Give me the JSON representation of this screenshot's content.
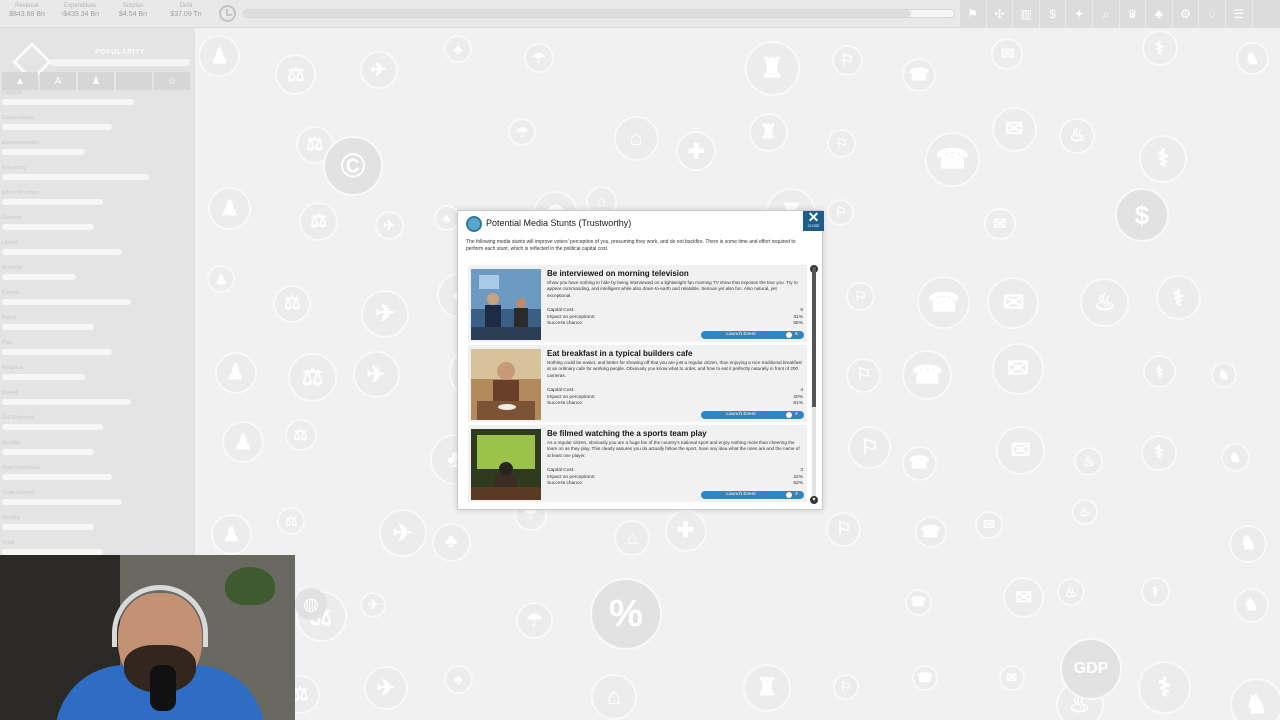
{
  "topbar": {
    "stats": [
      {
        "label": "Revenue",
        "value": "$843.88 Bn"
      },
      {
        "label": "Expenditure",
        "value": "-$439.34 Bn"
      },
      {
        "label": "Surplus",
        "value": "$4.54 Bn"
      },
      {
        "label": "Debt",
        "value": "$37.09 Tn"
      }
    ],
    "time_progress": 0.94,
    "icons": [
      "flag-icon",
      "network-icon",
      "chart-icon",
      "dollar-icon",
      "lightbulb-icon",
      "search-icon",
      "trophy-icon",
      "people-icon",
      "gear-icon",
      "bulb-icon",
      "menu-icon"
    ]
  },
  "left_panel": {
    "title": "POPULARITY",
    "tabs": [
      "up-arrow-icon",
      "text-icon",
      "people-icon",
      "blank-icon",
      "face-icon"
    ],
    "rows": [
      {
        "label": "Capitalist",
        "fill": 0.72
      },
      {
        "label": "Conservatives",
        "fill": 0.6
      },
      {
        "label": "Environmentalist",
        "fill": 0.45
      },
      {
        "label": "Everybody",
        "fill": 0.8
      },
      {
        "label": "Ethnic Minorities",
        "fill": 0.55
      },
      {
        "label": "Farmers",
        "fill": 0.5
      },
      {
        "label": "Liberal",
        "fill": 0.65
      },
      {
        "label": "Motorists",
        "fill": 0.4
      },
      {
        "label": "Parents",
        "fill": 0.7
      },
      {
        "label": "Patriot",
        "fill": 0.5
      },
      {
        "label": "Poor",
        "fill": 0.6
      },
      {
        "label": "Religious",
        "fill": 0.45
      },
      {
        "label": "Retired",
        "fill": 0.7
      },
      {
        "label": "Self Employed",
        "fill": 0.55
      },
      {
        "label": "Socialist",
        "fill": 0.5
      },
      {
        "label": "State Employees",
        "fill": 0.6
      },
      {
        "label": "Trade Unionist",
        "fill": 0.65
      },
      {
        "label": "Wealthy",
        "fill": 0.5
      },
      {
        "label": "Youth",
        "fill": 0.55
      }
    ]
  },
  "background_icons": [
    {
      "name": "percent-icon",
      "glyph": "%"
    },
    {
      "name": "gdp-icon",
      "glyph": "GDP"
    },
    {
      "name": "copyright-icon",
      "glyph": "©"
    },
    {
      "name": "dollar-icon",
      "glyph": "$"
    }
  ],
  "dialog": {
    "title": "Potential Media Stunts (Trustworthy)",
    "close_label": "CLOSE",
    "description": "The following media stunts will improve voters' perception of you, presuming they work, and do not backfire. There is some time and effort required to perform each stunt, which is reflected in the political capital cost.",
    "stat_labels": {
      "cost": "Capital Cost:",
      "impact": "Impact on perceptions:",
      "success": "Success chance:"
    },
    "launch_label": "Launch Event",
    "items": [
      {
        "title": "Be interviewed on morning television",
        "description": "Show you have nothing to hide by being interviewed on a lightweight fun morning TV show that exposes the true you. Try to appear commanding, and intelligent while also down-to-earth and relatable. Serious yet also fun. Also natural, yet exceptional.",
        "cost": "5",
        "impact": "31%",
        "success": "65%",
        "launch_cost": "5"
      },
      {
        "title": "Eat breakfast in a typical builders cafe",
        "description": "Nothing could be easier, and better for showing off that you are just a regular citizen, than enjoying a nice traditional breakfast at an ordinary cafe for working people. Obviously you know what to order, and how to eat it perfectly naturally in front of 200 cameras.",
        "cost": "4",
        "impact": "20%",
        "success": "81%",
        "launch_cost": "4"
      },
      {
        "title": "Be filmed watching the a sports team play",
        "description": "As a regular citizen, obviously you are a huge fan of the country's national sport and enjoy nothing more than cheering the team on as they play. This clearly assures you do actually follow the sport, have any idea what the rules are and the name of at least one player.",
        "cost": "3",
        "impact": "22%",
        "success": "62%",
        "launch_cost": "3"
      }
    ]
  },
  "colors": {
    "accent": "#2a87c9",
    "close": "#1d5d8b",
    "background": "#f1f1f1"
  }
}
